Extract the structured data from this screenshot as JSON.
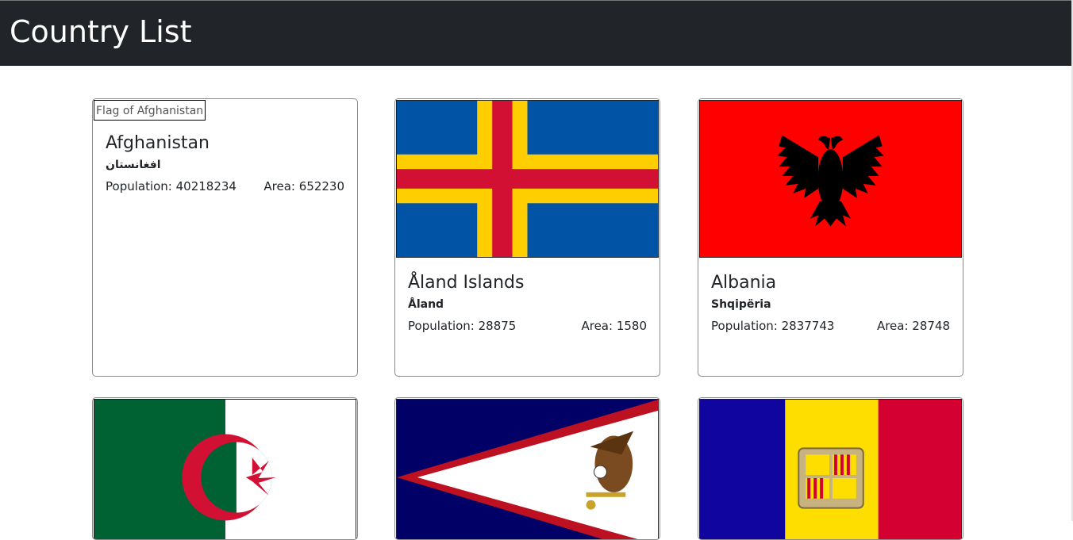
{
  "header": {
    "title": "Country List"
  },
  "countries": [
    {
      "name": "Afghanistan",
      "native": "افغانستان",
      "population_label": "Population: 40218234",
      "area_label": "Area: 652230",
      "flag_alt": "Flag of Afghanistan",
      "flag_icon": "broken-image-icon"
    },
    {
      "name": "Åland Islands",
      "native": "Åland",
      "population_label": "Population: 28875",
      "area_label": "Area: 1580",
      "flag_alt": "Flag of Åland Islands",
      "flag_icon": "aland-flag-icon"
    },
    {
      "name": "Albania",
      "native": "Shqipëria",
      "population_label": "Population: 2837743",
      "area_label": "Area: 28748",
      "flag_alt": "Flag of Albania",
      "flag_icon": "albania-flag-icon"
    },
    {
      "flag_alt": "Flag of Algeria",
      "flag_icon": "algeria-flag-icon"
    },
    {
      "flag_alt": "Flag of American Samoa",
      "flag_icon": "american-samoa-flag-icon"
    },
    {
      "flag_alt": "Flag of Andorra",
      "flag_icon": "andorra-flag-icon"
    }
  ],
  "colors": {
    "navbar": "#212529",
    "aland_blue": "#0053a5",
    "aland_yellow": "#ffce00",
    "aland_red": "#d21034",
    "albania_red": "#ff0000",
    "algeria_green": "#006233",
    "algeria_red": "#d21034",
    "samoa_blue": "#000066",
    "samoa_red": "#bd1021",
    "andorra_blue": "#10069f",
    "andorra_yellow": "#fedd00",
    "andorra_red": "#d50032"
  }
}
